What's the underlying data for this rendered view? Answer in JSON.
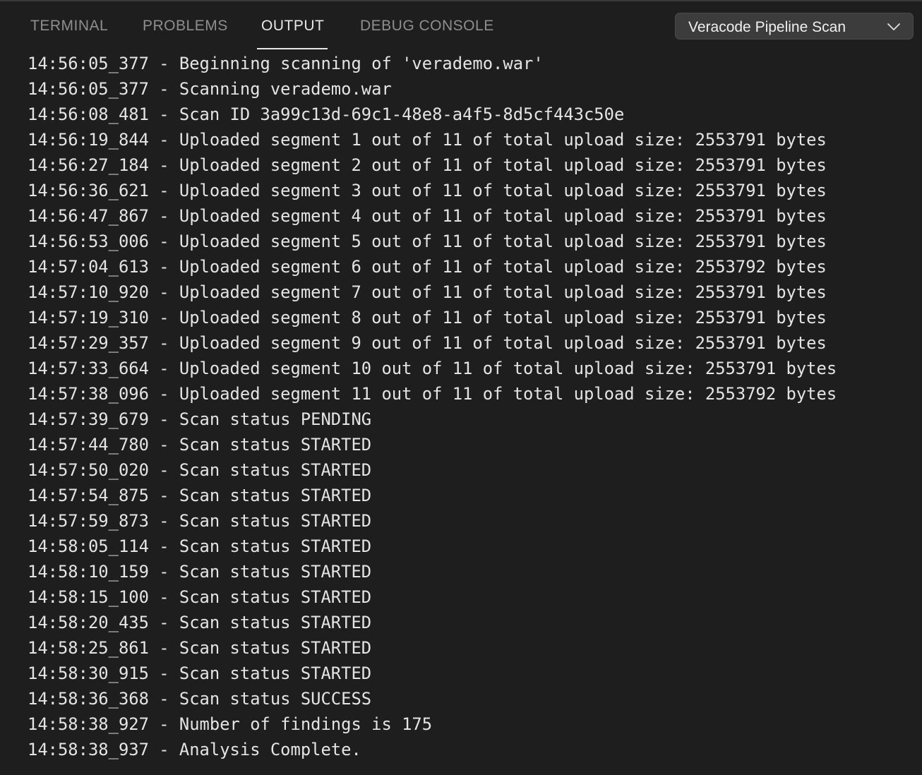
{
  "tabs": [
    {
      "label": "TERMINAL",
      "active": false
    },
    {
      "label": "PROBLEMS",
      "active": false
    },
    {
      "label": "OUTPUT",
      "active": true
    },
    {
      "label": "DEBUG CONSOLE",
      "active": false
    }
  ],
  "channel_select": {
    "selected": "Veracode Pipeline Scan",
    "icon": "chevron-down-icon"
  },
  "colors": {
    "background": "#1e1e1e",
    "text": "#e4e4e4",
    "tab_inactive": "#8e8e8e",
    "tab_active": "#e7e7e7",
    "dropdown_bg": "#3c3c3c"
  },
  "output_lines": [
    "14:56:05_377 - Beginning scanning of 'verademo.war'",
    "14:56:05_377 - Scanning verademo.war",
    "14:56:08_481 - Scan ID 3a99c13d-69c1-48e8-a4f5-8d5cf443c50e",
    "14:56:19_844 - Uploaded segment 1 out of 11 of total upload size: 2553791 bytes",
    "14:56:27_184 - Uploaded segment 2 out of 11 of total upload size: 2553791 bytes",
    "14:56:36_621 - Uploaded segment 3 out of 11 of total upload size: 2553791 bytes",
    "14:56:47_867 - Uploaded segment 4 out of 11 of total upload size: 2553791 bytes",
    "14:56:53_006 - Uploaded segment 5 out of 11 of total upload size: 2553791 bytes",
    "14:57:04_613 - Uploaded segment 6 out of 11 of total upload size: 2553792 bytes",
    "14:57:10_920 - Uploaded segment 7 out of 11 of total upload size: 2553791 bytes",
    "14:57:19_310 - Uploaded segment 8 out of 11 of total upload size: 2553791 bytes",
    "14:57:29_357 - Uploaded segment 9 out of 11 of total upload size: 2553791 bytes",
    "14:57:33_664 - Uploaded segment 10 out of 11 of total upload size: 2553791 bytes",
    "14:57:38_096 - Uploaded segment 11 out of 11 of total upload size: 2553792 bytes",
    "14:57:39_679 - Scan status PENDING",
    "14:57:44_780 - Scan status STARTED",
    "14:57:50_020 - Scan status STARTED",
    "14:57:54_875 - Scan status STARTED",
    "14:57:59_873 - Scan status STARTED",
    "14:58:05_114 - Scan status STARTED",
    "14:58:10_159 - Scan status STARTED",
    "14:58:15_100 - Scan status STARTED",
    "14:58:20_435 - Scan status STARTED",
    "14:58:25_861 - Scan status STARTED",
    "14:58:30_915 - Scan status STARTED",
    "14:58:36_368 - Scan status SUCCESS",
    "14:58:38_927 - Number of findings is 175",
    "14:58:38_937 - Analysis Complete."
  ]
}
